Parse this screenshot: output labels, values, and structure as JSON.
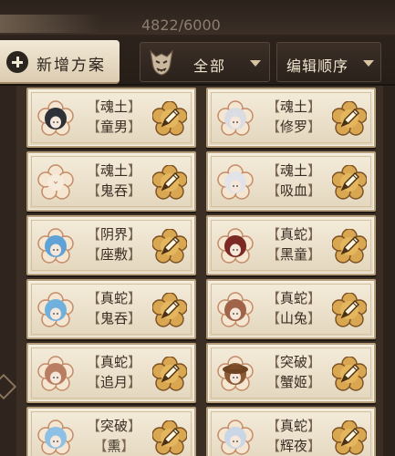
{
  "header": {
    "counter": "4822/6000"
  },
  "toolbar": {
    "new_plan_label": "新增方案",
    "filter_label": "全部",
    "sort_label": "编辑顺序"
  },
  "colors": {
    "card_bg": "#f4ecdb",
    "frame": "#3a2e25",
    "accent": "#d4a24a"
  },
  "cards": [
    {
      "line1": "魂土",
      "line2": "童男",
      "avatar": "dark-armored-shikigami-icon",
      "tint": "#2e3238"
    },
    {
      "line1": "魂土",
      "line2": "修罗",
      "avatar": "white-haired-shikigami-icon",
      "tint": "#d9dde3"
    },
    {
      "line1": "魂土",
      "line2": "鬼吞",
      "avatar": "empty-plum-flower-icon",
      "tint": "#f2e1c9"
    },
    {
      "line1": "魂土",
      "line2": "吸血",
      "avatar": "white-haired-shikigami-icon",
      "tint": "#e1e3e8"
    },
    {
      "line1": "阴界",
      "line2": "座敷",
      "avatar": "blue-haired-shikigami-icon",
      "tint": "#5fa3d6"
    },
    {
      "line1": "真蛇",
      "line2": "黑童",
      "avatar": "red-haired-shikigami-icon",
      "tint": "#7a2a22"
    },
    {
      "line1": "真蛇",
      "line2": "鬼吞",
      "avatar": "blue-haired-shikigami-icon",
      "tint": "#6fb0dd"
    },
    {
      "line1": "真蛇",
      "line2": "山兔",
      "avatar": "brown-haired-shikigami-icon",
      "tint": "#a0644a"
    },
    {
      "line1": "真蛇",
      "line2": "追月",
      "avatar": "brown-haired-shikigami-icon",
      "tint": "#b97e62"
    },
    {
      "line1": "突破",
      "line2": "蟹姬",
      "avatar": "straw-hat-shikigami-icon",
      "tint": "#8a5a35"
    },
    {
      "line1": "突破",
      "line2": "熏",
      "avatar": "blue-haired-shikigami-icon",
      "tint": "#8cc0e4"
    },
    {
      "line1": "真蛇",
      "line2": "辉夜",
      "avatar": "white-haired-shikigami-icon",
      "tint": "#c9d6e6"
    }
  ],
  "edit_icon": "gold-edit-icon"
}
